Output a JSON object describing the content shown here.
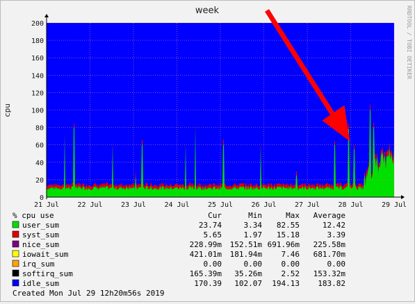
{
  "chart_data": {
    "type": "area",
    "title": "week",
    "ylabel": "cpu",
    "watermark": "RRDTOOL / TOBI OETIKER",
    "ylim": [
      0,
      200
    ],
    "y_ticks": [
      0,
      20,
      40,
      60,
      80,
      100,
      120,
      140,
      160,
      180,
      200
    ],
    "x_ticks": [
      "21 Jul",
      "22 Jul",
      "23 Jul",
      "24 Jul",
      "25 Jul",
      "26 Jul",
      "27 Jul",
      "28 Jul",
      "29 Jul"
    ],
    "grid": true,
    "stacked": true,
    "annotation": "red arrow pointing at spike near 28 Jul",
    "base": {
      "user_sum": 8,
      "syst_sum": 3
    },
    "spikes": [
      {
        "day": 0.42,
        "user": 70
      },
      {
        "day": 0.63,
        "user": 80
      },
      {
        "day": 1.52,
        "user": 60
      },
      {
        "day": 2.05,
        "user": 25
      },
      {
        "day": 2.2,
        "user": 60
      },
      {
        "day": 3.2,
        "user": 60
      },
      {
        "day": 3.42,
        "user": 80
      },
      {
        "day": 4.07,
        "user": 60
      },
      {
        "day": 4.93,
        "user": 60
      },
      {
        "day": 5.75,
        "user": 25
      },
      {
        "day": 6.63,
        "user": 60
      },
      {
        "day": 6.95,
        "user": 78
      },
      {
        "day": 7.08,
        "user": 55
      },
      {
        "day": 7.45,
        "user": 100
      },
      {
        "day": 7.53,
        "user": 80
      }
    ],
    "legend": {
      "header": [
        "% cpu use",
        "Cur",
        "Min",
        "Max",
        "Average"
      ],
      "rows": [
        {
          "name": "user_sum",
          "color": "#00e000",
          "cur": "23.74",
          "min": "3.34",
          "max": "82.55",
          "avg": "12.42"
        },
        {
          "name": "syst_sum",
          "color": "#e00000",
          "cur": "5.65",
          "min": "1.97",
          "max": "15.18",
          "avg": "3.39"
        },
        {
          "name": "nice_sum",
          "color": "#800080",
          "cur": "228.99m",
          "min": "152.51m",
          "max": "691.96m",
          "avg": "225.58m"
        },
        {
          "name": "iowait_sum",
          "color": "#ffff00",
          "cur": "421.01m",
          "min": "181.94m",
          "max": "7.46",
          "avg": "681.70m"
        },
        {
          "name": "irq_sum",
          "color": "#ffa500",
          "cur": "0.00",
          "min": "0.00",
          "max": "0.00",
          "avg": "0.00"
        },
        {
          "name": "softirq_sum",
          "color": "#000000",
          "cur": "165.39m",
          "min": "35.26m",
          "max": "2.52",
          "avg": "153.32m"
        },
        {
          "name": "idle_sum",
          "color": "#0000ff",
          "cur": "170.39",
          "min": "102.07",
          "max": "194.13",
          "avg": "183.82"
        }
      ]
    },
    "created": "Created Mon Jul 29 12h20m56s 2019"
  },
  "colors": {
    "idle": "#0000ff",
    "user": "#00e000",
    "syst": "#e00000",
    "arrow": "#ff0000",
    "grid": "#e08080"
  }
}
